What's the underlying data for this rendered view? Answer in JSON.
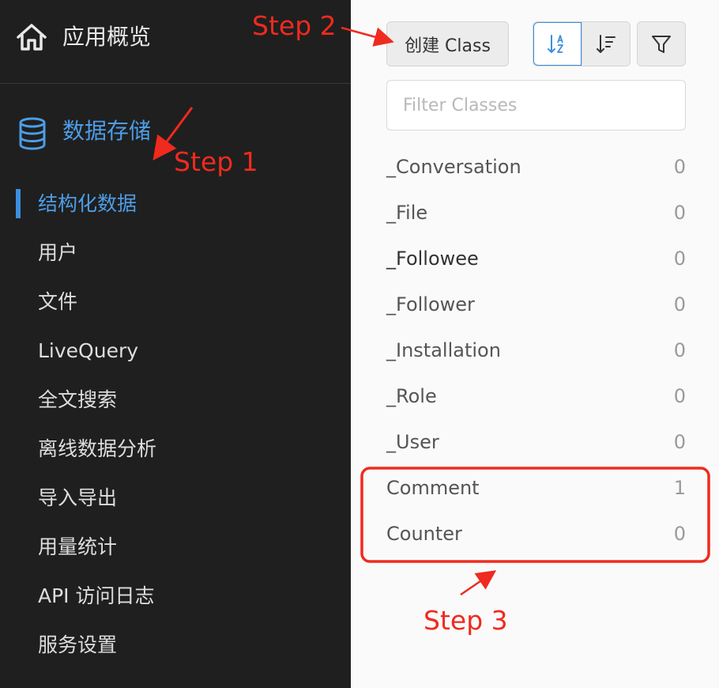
{
  "sidebar": {
    "app_title": "应用概览",
    "section_title": "数据存储",
    "items": [
      {
        "label": "结构化数据",
        "active": true
      },
      {
        "label": "用户"
      },
      {
        "label": "文件"
      },
      {
        "label": "LiveQuery"
      },
      {
        "label": "全文搜索"
      },
      {
        "label": "离线数据分析"
      },
      {
        "label": "导入导出"
      },
      {
        "label": "用量统计"
      },
      {
        "label": "API 访问日志"
      },
      {
        "label": "服务设置"
      }
    ]
  },
  "toolbar": {
    "create_label": "创建 Class",
    "sort_alpha_icon": "sort-alpha-icon",
    "sort_count_icon": "sort-count-icon",
    "filter_icon": "funnel-icon"
  },
  "filter": {
    "placeholder": "Filter Classes",
    "value": ""
  },
  "classes": [
    {
      "name": "_Conversation",
      "count": "0"
    },
    {
      "name": "_File",
      "count": "0"
    },
    {
      "name": "_Followee",
      "count": "0"
    },
    {
      "name": "_Follower",
      "count": "0"
    },
    {
      "name": "_Installation",
      "count": "0"
    },
    {
      "name": "_Role",
      "count": "0"
    },
    {
      "name": "_User",
      "count": "0"
    },
    {
      "name": "Comment",
      "count": "1"
    },
    {
      "name": "Counter",
      "count": "0"
    }
  ],
  "annotations": {
    "step1": "Step 1",
    "step2": "Step 2",
    "step3": "Step 3"
  },
  "colors": {
    "sidebar_bg": "#1f1f1f",
    "accent_blue": "#3b8fe0",
    "annotation_red": "#f02a1e"
  }
}
